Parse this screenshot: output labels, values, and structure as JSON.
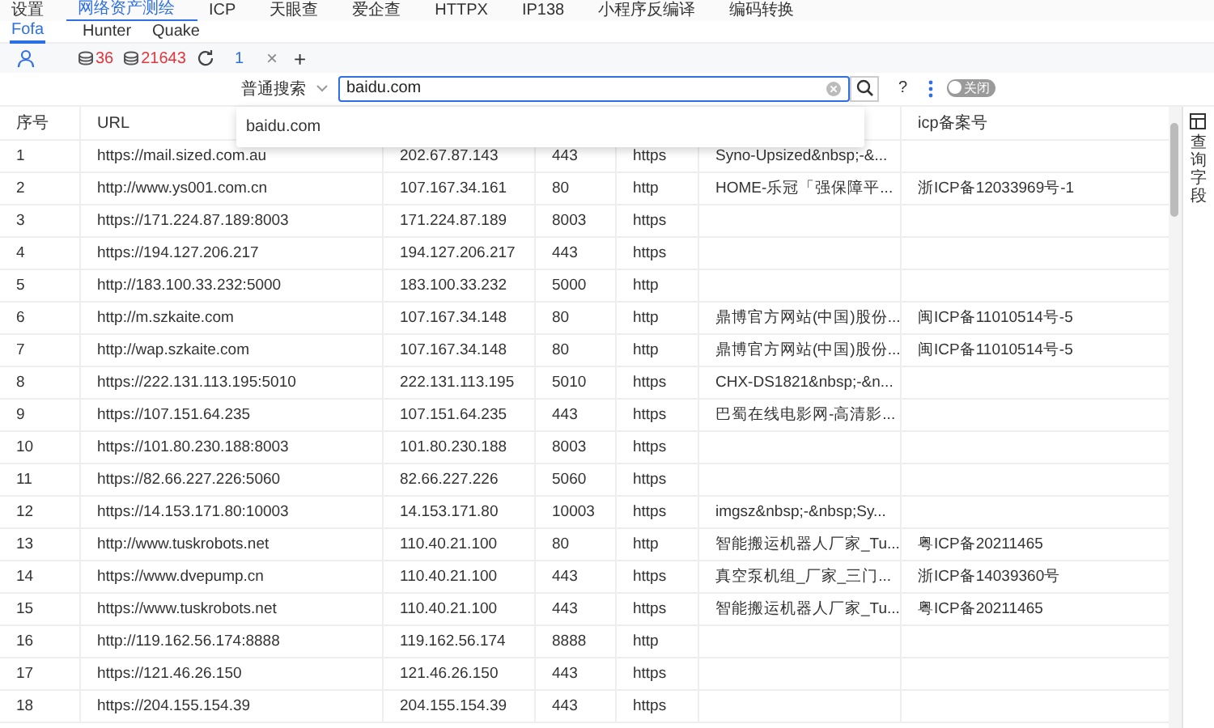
{
  "menu": [
    {
      "label": "设置",
      "selected": false
    },
    {
      "label": "网络资产测绘",
      "selected": true
    },
    {
      "label": "ICP",
      "selected": false
    },
    {
      "label": "天眼查",
      "selected": false
    },
    {
      "label": "爱企查",
      "selected": false
    },
    {
      "label": "HTTPX",
      "selected": false
    },
    {
      "label": "IP138",
      "selected": false
    },
    {
      "label": "小程序反编译",
      "selected": false
    },
    {
      "label": "编码转换",
      "selected": false
    }
  ],
  "engines": [
    {
      "label": "Fofa",
      "selected": true
    },
    {
      "label": "Hunter",
      "selected": false
    },
    {
      "label": "Quake",
      "selected": false
    }
  ],
  "toolbar": {
    "count_1": "36",
    "count_2": "21643",
    "tabs": [
      {
        "label": "1",
        "selected": true
      }
    ],
    "close": "×",
    "add": "+"
  },
  "search": {
    "mode": "普通搜索",
    "value": "baidu.com",
    "help": "?",
    "toggle_label": "关闭",
    "toggle_on": false,
    "suggestions": [
      "baidu.com"
    ]
  },
  "table": {
    "columns": [
      "序号",
      "URL",
      "",
      "",
      "",
      "",
      "icp备案号"
    ],
    "rows": [
      [
        "1",
        "https://mail.sized.com.au",
        "202.67.87.143",
        "443",
        "https",
        "Syno-Upsized&nbsp;-&...",
        ""
      ],
      [
        "2",
        "http://www.ys001.com.cn",
        "107.167.34.161",
        "80",
        "http",
        "HOME-乐冠「强保障平...",
        "浙ICP备12033969号-1"
      ],
      [
        "3",
        "https://171.224.87.189:8003",
        "171.224.87.189",
        "8003",
        "https",
        "",
        ""
      ],
      [
        "4",
        "https://194.127.206.217",
        "194.127.206.217",
        "443",
        "https",
        "",
        ""
      ],
      [
        "5",
        "http://183.100.33.232:5000",
        "183.100.33.232",
        "5000",
        "http",
        "",
        ""
      ],
      [
        "6",
        "http://m.szkaite.com",
        "107.167.34.148",
        "80",
        "http",
        "鼎博官方网站(中国)股份...",
        "闽ICP备11010514号-5"
      ],
      [
        "7",
        "http://wap.szkaite.com",
        "107.167.34.148",
        "80",
        "http",
        "鼎博官方网站(中国)股份...",
        "闽ICP备11010514号-5"
      ],
      [
        "8",
        "https://222.131.113.195:5010",
        "222.131.113.195",
        "5010",
        "https",
        "CHX-DS1821&nbsp;-&n...",
        ""
      ],
      [
        "9",
        "https://107.151.64.235",
        "107.151.64.235",
        "443",
        "https",
        "巴蜀在线电影网-高清影...",
        ""
      ],
      [
        "10",
        "https://101.80.230.188:8003",
        "101.80.230.188",
        "8003",
        "https",
        "",
        ""
      ],
      [
        "11",
        "https://82.66.227.226:5060",
        "82.66.227.226",
        "5060",
        "https",
        "",
        ""
      ],
      [
        "12",
        "https://14.153.171.80:10003",
        "14.153.171.80",
        "10003",
        "https",
        "imgsz&nbsp;-&nbsp;Sy...",
        ""
      ],
      [
        "13",
        "http://www.tuskrobots.net",
        "110.40.21.100",
        "80",
        "http",
        "智能搬运机器人厂家_Tu...",
        "粤ICP备20211465"
      ],
      [
        "14",
        "https://www.dvepump.cn",
        "110.40.21.100",
        "443",
        "https",
        "真空泵机组_厂家_三门...",
        "浙ICP备14039360号"
      ],
      [
        "15",
        "https://www.tuskrobots.net",
        "110.40.21.100",
        "443",
        "https",
        "智能搬运机器人厂家_Tu...",
        "粤ICP备20211465"
      ],
      [
        "16",
        "http://119.162.56.174:8888",
        "119.162.56.174",
        "8888",
        "http",
        "",
        ""
      ],
      [
        "17",
        "https://121.46.26.150",
        "121.46.26.150",
        "443",
        "https",
        "",
        ""
      ],
      [
        "18",
        "https://204.155.154.39",
        "204.155.154.39",
        "443",
        "https",
        "",
        ""
      ]
    ]
  },
  "side_panel": {
    "label": "查询字段"
  }
}
